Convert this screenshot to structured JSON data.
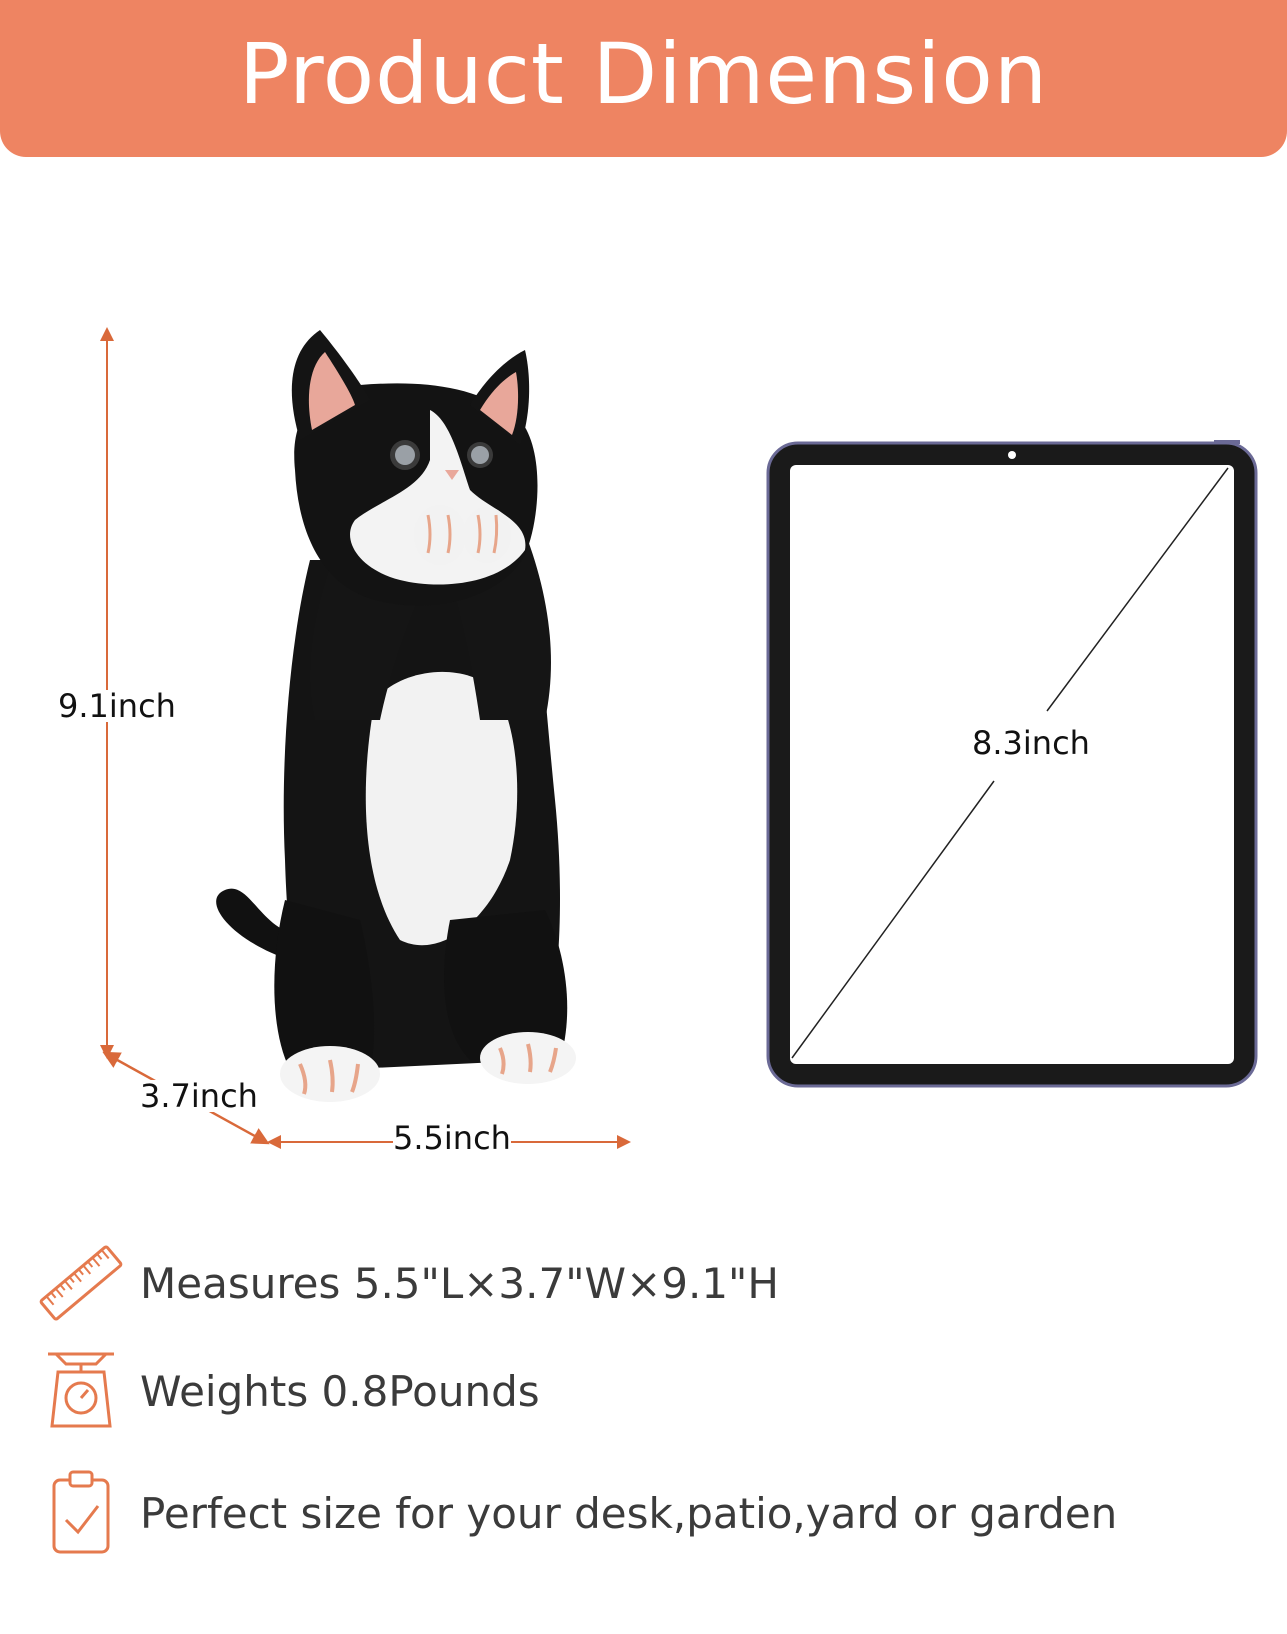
{
  "header": {
    "title": "Product Dimension",
    "background_color": "#ee8462"
  },
  "dimensions": {
    "height_label": "9.1inch",
    "depth_label": "3.7inch",
    "length_label": "5.5inch",
    "tablet_diagonal_label": "8.3inch",
    "line_color": "#d9693a"
  },
  "features": [
    {
      "icon": "ruler-icon",
      "text": "Measures 5.5\"L×3.7\"W×9.1\"H"
    },
    {
      "icon": "scale-icon",
      "text": "Weights  0.8Pounds"
    },
    {
      "icon": "clipboard-check-icon",
      "text": "Perfect size for your desk,patio,yard or garden"
    }
  ],
  "accent_color": "#e57a4e"
}
